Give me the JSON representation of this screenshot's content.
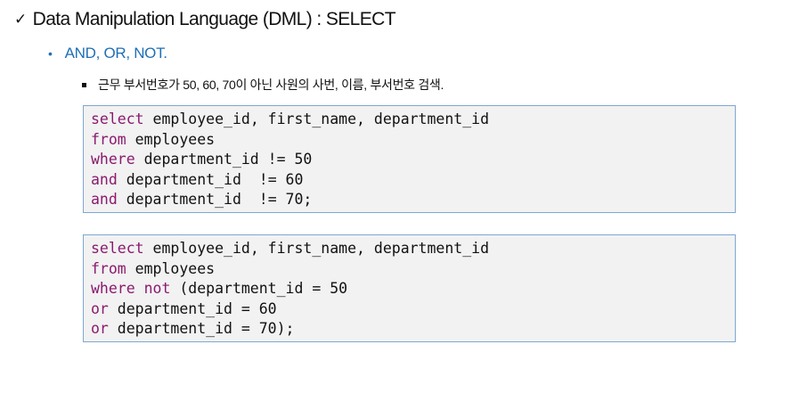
{
  "heading": {
    "check": "✓",
    "title": "Data Manipulation Language (DML) : SELECT"
  },
  "subheading": {
    "bullet": "•",
    "text": "AND, OR, NOT."
  },
  "description": {
    "text": "근무 부서번호가 50, 60, 70이 아닌 사원의 사번, 이름, 부서번호 검색."
  },
  "query1": {
    "lines": [
      {
        "kw": "select",
        "rest": " employee_id, first_name, department_id"
      },
      {
        "kw": "from",
        "rest": " employees"
      },
      {
        "kw": "where",
        "rest": " department_id != 50"
      },
      {
        "kw": "and",
        "rest": " department_id  != 60"
      },
      {
        "kw": "and",
        "rest": " department_id  != 70;"
      }
    ]
  },
  "query2": {
    "lines": [
      {
        "kw": "select",
        "rest": " employee_id, first_name, department_id"
      },
      {
        "kw": "from",
        "rest": " employees"
      },
      {
        "kw": "where not",
        "rest": " (department_id = 50"
      },
      {
        "kw": "or",
        "rest": " department_id = 60"
      },
      {
        "kw": "or",
        "rest": " department_id = 70);"
      }
    ]
  },
  "colors": {
    "keyword": "#8b1a6e",
    "subheading": "#1f6fb7",
    "code_border": "#7fa7d3",
    "code_background": "#f2f2f2"
  }
}
